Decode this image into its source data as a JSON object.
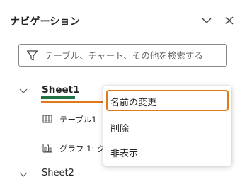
{
  "pane": {
    "title": "ナビゲーション",
    "collapse_icon": "chevron-down-icon",
    "close_icon": "close-icon"
  },
  "search": {
    "placeholder": "テーブル、チャート、その他を検索する",
    "value": "",
    "icon": "filter-icon"
  },
  "tree": {
    "sheets": [
      {
        "label": "Sheet1",
        "expanded": true
      },
      {
        "label": "Sheet2",
        "expanded": false
      }
    ],
    "sheet1_children": [
      {
        "label": "テーブル1",
        "icon": "table-icon"
      },
      {
        "label": "グラフ 1: グ",
        "icon": "bar-chart-icon"
      }
    ]
  },
  "context_menu": {
    "items": [
      {
        "label": "名前の変更",
        "selected": true
      },
      {
        "label": "削除",
        "selected": false
      },
      {
        "label": "非表示",
        "selected": false
      }
    ]
  },
  "colors": {
    "accent_orange": "#e07a18",
    "sheet_tab_green": "#217346",
    "text": "#242424"
  }
}
